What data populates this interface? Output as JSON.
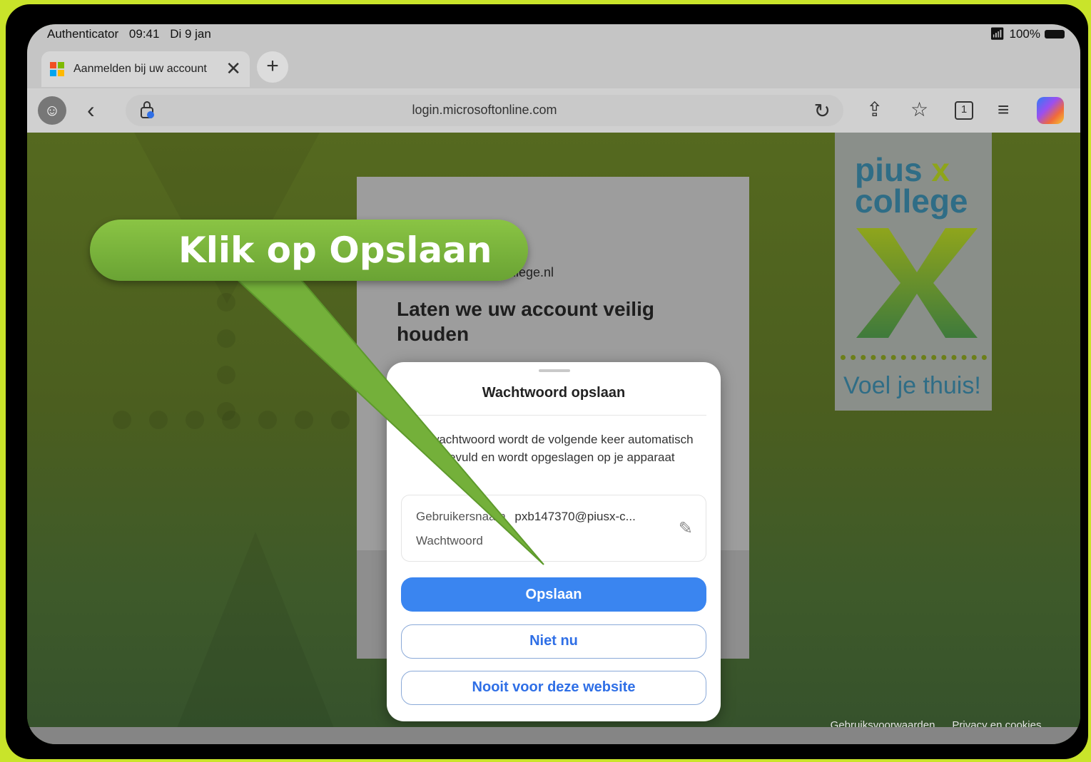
{
  "status_bar": {
    "back_app": "Authenticator",
    "time": "09:41",
    "date": "Di 9 jan",
    "battery": "100%"
  },
  "tab": {
    "title": "Aanmelden bij uw account",
    "close_icon": "close-icon",
    "new_tab_icon": "plus-icon"
  },
  "toolbar": {
    "url": "login.microsoftonline.com",
    "icons": [
      "profile-icon",
      "back-icon",
      "lock-icon",
      "reload-icon",
      "share-icon",
      "favorite-icon",
      "tabs-icon",
      "menu-icon",
      "copilot-icon"
    ],
    "tab_count": "1"
  },
  "page": {
    "email_fragment": "college.nl",
    "heading": "Laten we uw account veilig houden",
    "footer": {
      "terms": "Gebruiksvoorwaarden",
      "privacy": "Privacy en cookies",
      "more": "..."
    }
  },
  "school_logo": {
    "line1_a": "pius",
    "line1_b": "x",
    "line2": "college",
    "tagline": "Voel je thuis!"
  },
  "sheet": {
    "title": "Wachtwoord opslaan",
    "description": "Je wachtwoord wordt de volgende keer automatisch ingevuld en wordt opgeslagen op je apparaat",
    "username_label": "Gebruikersnaam",
    "username_value": "pxb147370@piusx-c...",
    "password_label": "Wachtwoord",
    "save_button": "Opslaan",
    "not_now_button": "Niet nu",
    "never_button": "Nooit voor deze website"
  },
  "callout": {
    "text": "Klik op Opslaan"
  },
  "colors": {
    "accent": "#3a85f0",
    "callout": "#7ab33c",
    "page_bg": "#4b5b22"
  }
}
